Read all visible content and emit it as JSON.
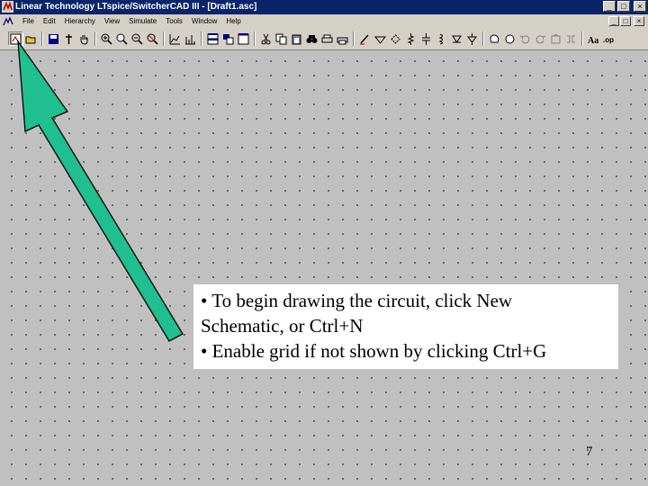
{
  "window": {
    "title": "Linear Technology LTspice/SwitcherCAD III - [Draft1.asc]",
    "minimize_glyph": "_",
    "maximize_glyph": "□",
    "close_glyph": "×"
  },
  "menu": {
    "items": [
      {
        "label": "File"
      },
      {
        "label": "Edit"
      },
      {
        "label": "Hierarchy"
      },
      {
        "label": "View"
      },
      {
        "label": "Simulate"
      },
      {
        "label": "Tools"
      },
      {
        "label": "Window"
      },
      {
        "label": "Help"
      }
    ],
    "mdi_minimize_glyph": "_",
    "mdi_restore_glyph": "□",
    "mdi_close_glyph": "×"
  },
  "toolbar": {
    "icons": [
      "new-schematic-icon",
      "open-icon",
      "save-icon",
      "control-panel-icon",
      "pan-icon",
      "zoom-in-icon",
      "zoom-full-icon",
      "zoom-out-icon",
      "zoom-cancel-icon",
      "autorange-icon",
      "fft-icon",
      "tile-horizontal-icon",
      "cascade-icon",
      "close-all-icon",
      "cut-icon",
      "copy-icon",
      "paste-icon",
      "find-icon",
      "print-icon",
      "print-preview-icon",
      "draw-wire-icon",
      "ground-icon",
      "net-label-icon",
      "resistor-icon",
      "capacitor-icon",
      "inductor-icon",
      "diode-icon",
      "component-icon",
      "move-icon",
      "drag-icon",
      "undo-icon",
      "redo-icon",
      "rotate-icon",
      "mirror-icon",
      "text-icon",
      "spice-directive-icon"
    ]
  },
  "slide": {
    "note_lines": [
      "• To begin drawing the circuit, click New",
      "Schematic, or Ctrl+N",
      "• Enable grid if not shown by clicking Ctrl+G"
    ],
    "page_number": "7",
    "arrow_color": "#1fbf8f"
  }
}
